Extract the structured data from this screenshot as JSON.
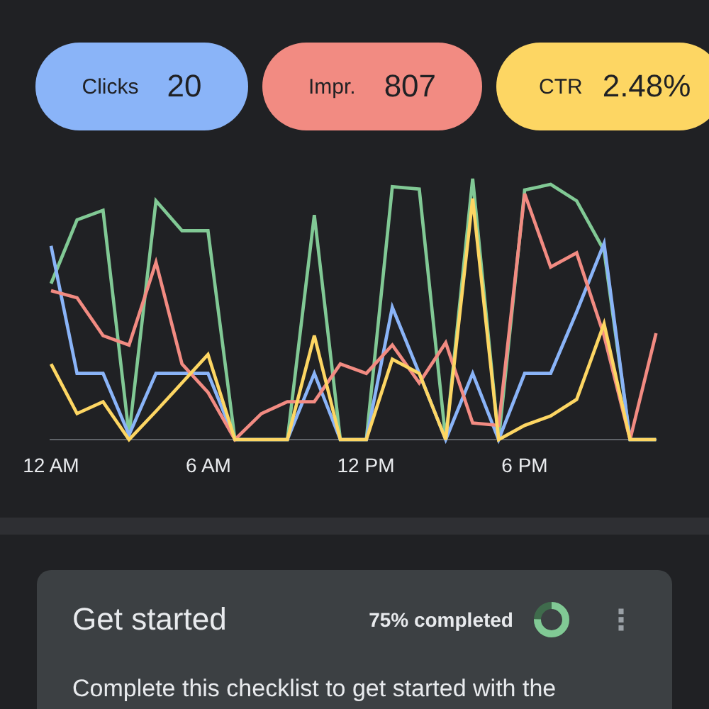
{
  "metrics": [
    {
      "label": "Clicks",
      "value": "20",
      "color": "#8ab4f8"
    },
    {
      "label": "Impr.",
      "value": "807",
      "color": "#f28b82"
    },
    {
      "label": "CTR",
      "value": "2.48%",
      "color": "#fdd663"
    }
  ],
  "chart": {
    "x_labels": [
      "12 AM",
      "6 AM",
      "12 PM",
      "6 PM"
    ]
  },
  "card": {
    "title": "Get started",
    "progress_text": "75% completed",
    "level": 0.75,
    "more_icon": "⋮",
    "body": "Complete this checklist to get started with the"
  }
}
